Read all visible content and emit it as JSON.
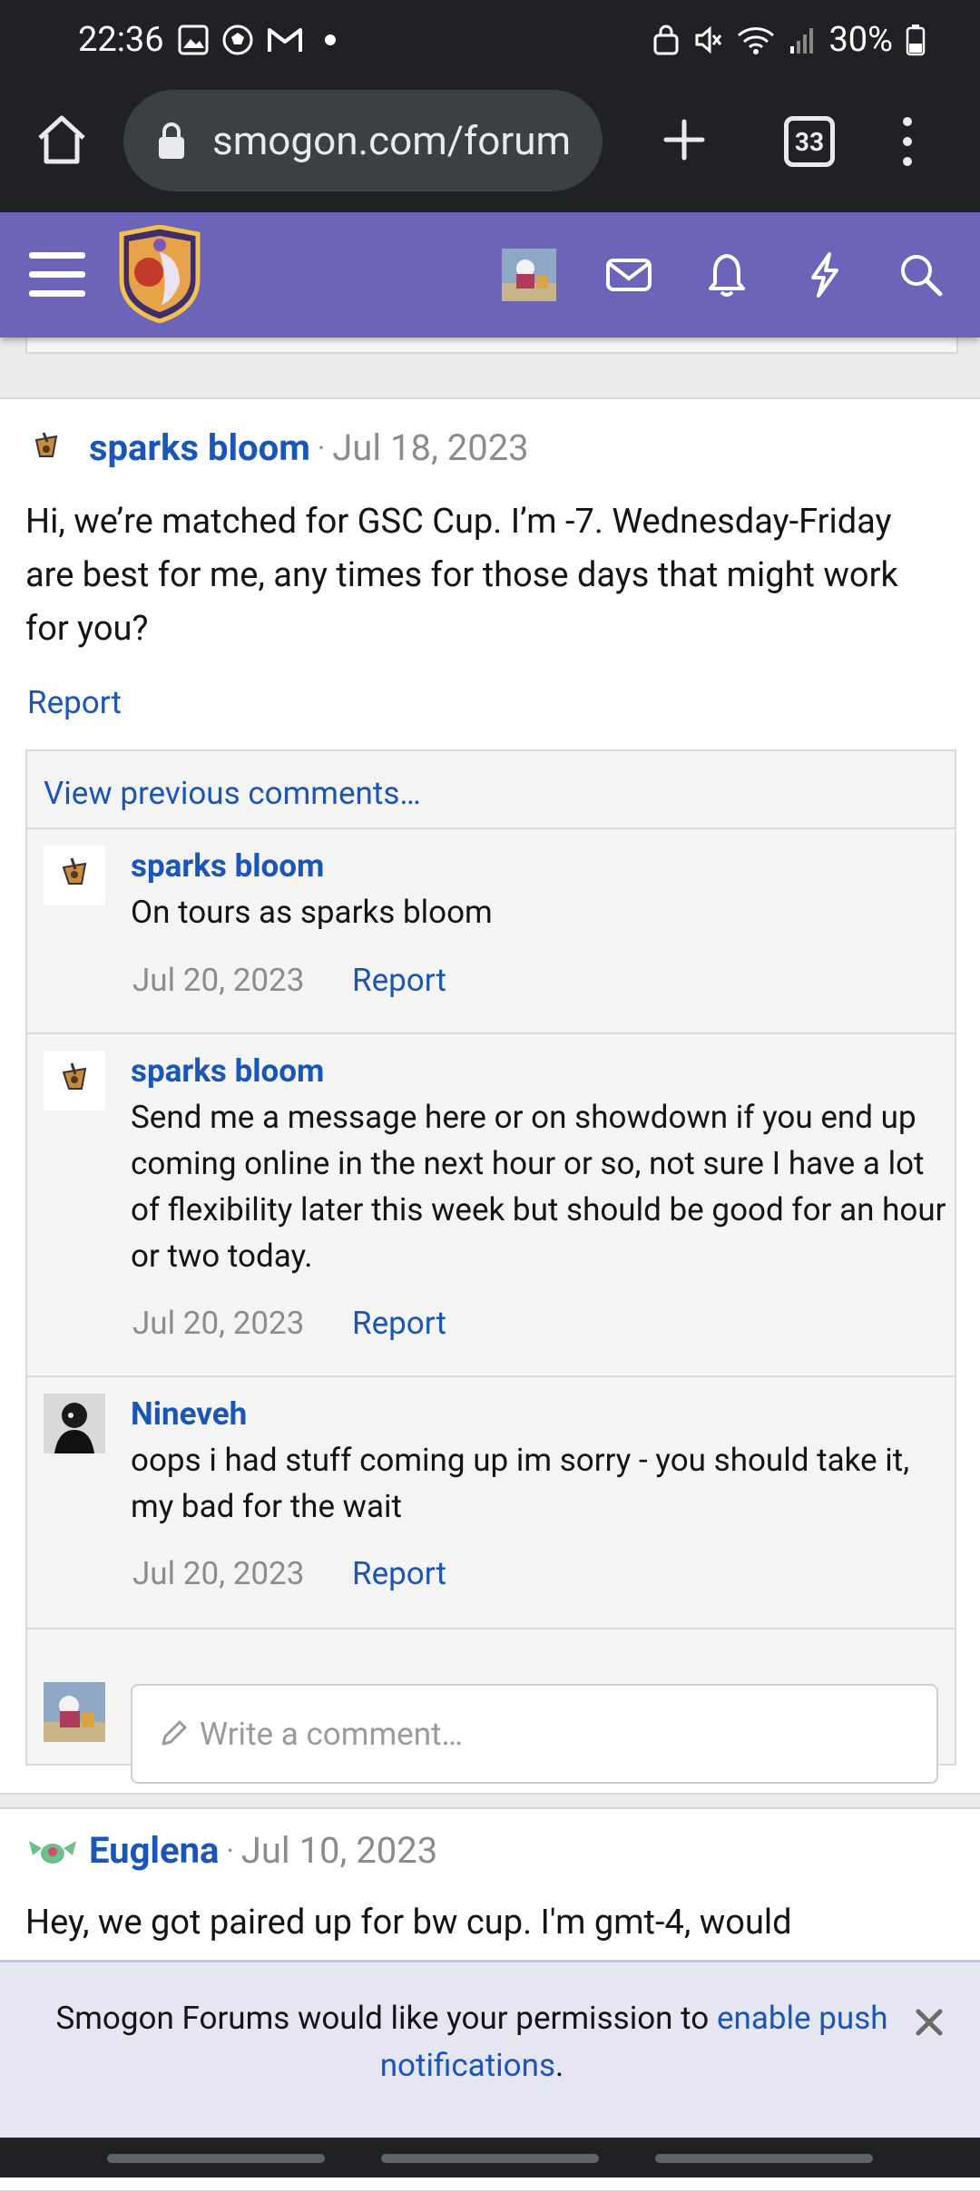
{
  "status_bar": {
    "time": "22:36",
    "battery": "30%",
    "left_icons": [
      "gallery-icon",
      "soccer-icon",
      "gmail-icon",
      "dot-icon"
    ],
    "right_icons": [
      "lock-icon",
      "mute-icon",
      "wifi-icon",
      "signal-icon",
      "battery-icon"
    ]
  },
  "browser": {
    "url": "smogon.com/forum",
    "tab_count": "33"
  },
  "posts": [
    {
      "author": "sparks bloom",
      "separator": "·",
      "date": "Jul 18, 2023",
      "body": "Hi, we’re matched for GSC Cup. I’m -7. Wednesday-Friday are best for me, any times for those days that might work for you?",
      "report": "Report",
      "view_previous": "View previous comments…",
      "comments": [
        {
          "author": "sparks bloom",
          "text": "On tours as sparks bloom",
          "date": "Jul 20, 2023",
          "report": "Report"
        },
        {
          "author": "sparks bloom",
          "text": "Send me a message here or on showdown if you end up coming online in the next hour or so, not sure I have a lot of flexibility later this week but should be good for an hour or two today.",
          "date": "Jul 20, 2023",
          "report": "Report"
        },
        {
          "author": "Nineveh",
          "text": "oops i had stuff coming up im sorry - you should take it, my bad for the wait",
          "date": "Jul 20, 2023",
          "report": "Report"
        }
      ],
      "comment_placeholder": "Write a comment…"
    },
    {
      "author": "Euglena",
      "separator": "·",
      "date": "Jul 10, 2023",
      "body": "Hey, we got paired up for bw cup. I'm gmt-4, would"
    }
  ],
  "push_banner": {
    "text_before": "Smogon Forums would like your permission to ",
    "link": "enable push notifications",
    "text_after": "."
  },
  "colors": {
    "header_bg": "#6d63b8",
    "link": "#1a56b8",
    "browser_bg": "#202124"
  }
}
